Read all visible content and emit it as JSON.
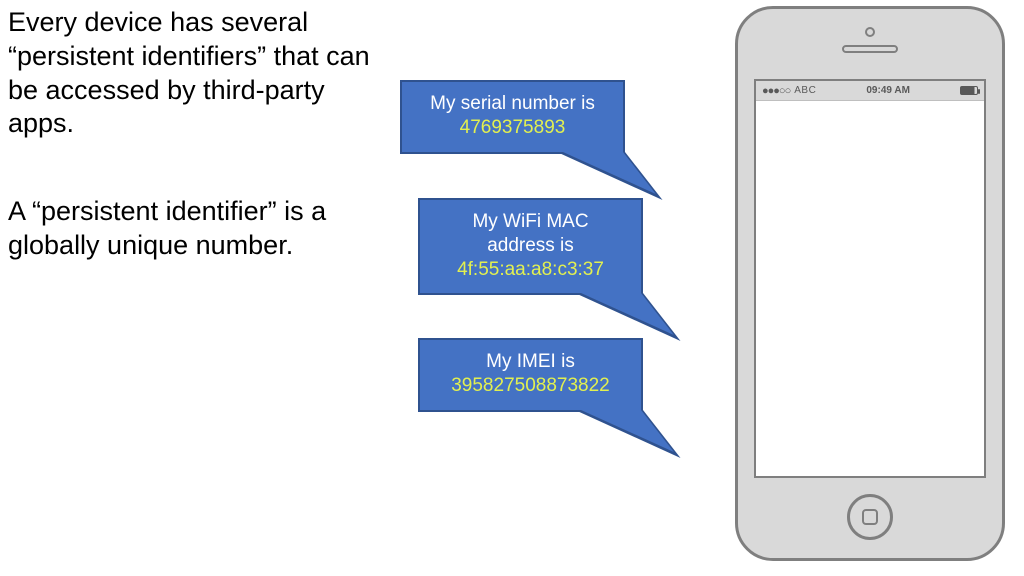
{
  "text": {
    "para1": "Every device has several “persistent identifiers” that can be accessed by third-party apps.",
    "para2": "A “persistent identifier” is a globally unique number."
  },
  "bubbles": {
    "serial": {
      "label": "My serial number is",
      "value": "4769375893"
    },
    "wifi": {
      "label_line1": "My WiFi MAC",
      "label_line2": "address is",
      "value": "4f:55:aa:a8:c3:37"
    },
    "imei": {
      "label": "My IMEI is",
      "value": "395827508873822"
    }
  },
  "phone": {
    "carrier": "ABC",
    "time": "09:49 AM",
    "signal_dots": "●●●○○"
  }
}
